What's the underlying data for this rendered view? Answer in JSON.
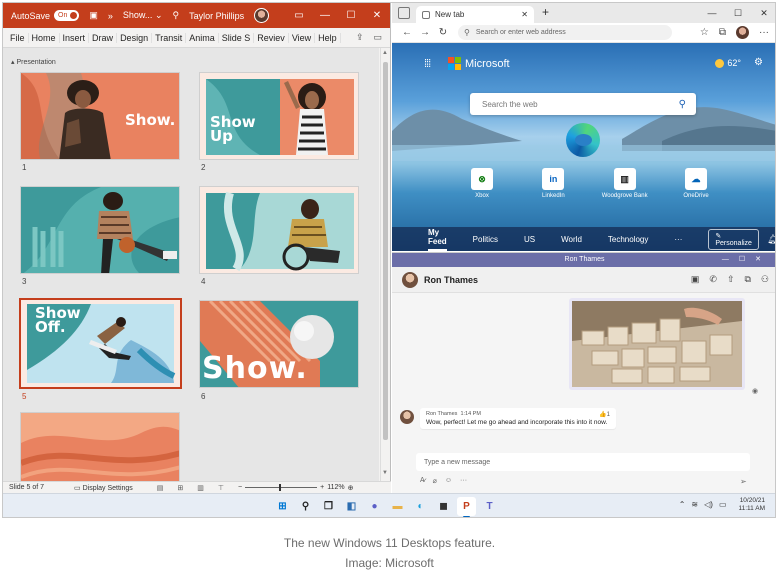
{
  "powerpoint": {
    "autosave_label": "AutoSave",
    "autosave_state": "On",
    "overflow": "»",
    "doc_name": "Show...",
    "user_name": "Taylor Phillips",
    "ribbon_tabs": [
      "File",
      "Home",
      "Insert",
      "Draw",
      "Design",
      "Transit",
      "Anima",
      "Slide S",
      "Reviev",
      "View",
      "Help"
    ],
    "section_label": "Presentation",
    "slides": [
      {
        "number": "1",
        "text": "Show."
      },
      {
        "number": "2",
        "text": "Show Up"
      },
      {
        "number": "3",
        "text": ""
      },
      {
        "number": "4",
        "text": ""
      },
      {
        "number": "5",
        "text": "Show Off.",
        "selected": true
      },
      {
        "number": "6",
        "text": "Show."
      },
      {
        "number": "",
        "text": ""
      }
    ],
    "status": {
      "slide_counter": "Slide 5 of 7",
      "display_settings": "Display Settings",
      "zoom_minus": "−",
      "zoom_plus": "+",
      "zoom": "112%"
    }
  },
  "edge": {
    "tab_title": "New tab",
    "tab_close": "✕",
    "new_tab": "+",
    "address_placeholder": "Search or enter web address",
    "brand": "Microsoft",
    "temperature": "62°",
    "search_placeholder": "Search the web",
    "quick_links": [
      {
        "label": "Xbox",
        "icon": "xbox-icon",
        "glyph": "⊗",
        "color": "#107c10"
      },
      {
        "label": "LinkedIn",
        "icon": "linkedin-icon",
        "glyph": "in",
        "color": "#0a66c2"
      },
      {
        "label": "Woodgrove Bank",
        "icon": "bank-icon",
        "glyph": "▥",
        "color": "#222222"
      },
      {
        "label": "OneDrive",
        "icon": "onedrive-icon",
        "glyph": "☁",
        "color": "#0364b8"
      }
    ],
    "feed_tabs": [
      "My Feed",
      "Politics",
      "US",
      "World",
      "Technology",
      "···"
    ],
    "personalize_label": "Personalize"
  },
  "teams": {
    "window_title": "Ron Thames",
    "contact_name": "Ron Thames",
    "message": {
      "sender": "Ron Thames",
      "time": "1:14 PM",
      "text": "Wow, perfect! Let me go ahead and incorporate this into it now.",
      "reaction": "👍1"
    },
    "compose_placeholder": "Type a new message"
  },
  "taskbar": {
    "date": "10/20/21",
    "time": "11:11 AM"
  },
  "caption": {
    "line1": "The new Windows 11 Desktops feature.",
    "line2": "Image: Microsoft"
  },
  "colors": {
    "powerpoint_accent": "#c43e1c",
    "teams_accent": "#6b6ea8",
    "slide_teal": "#3e9a9b",
    "slide_orange": "#e07a55"
  }
}
